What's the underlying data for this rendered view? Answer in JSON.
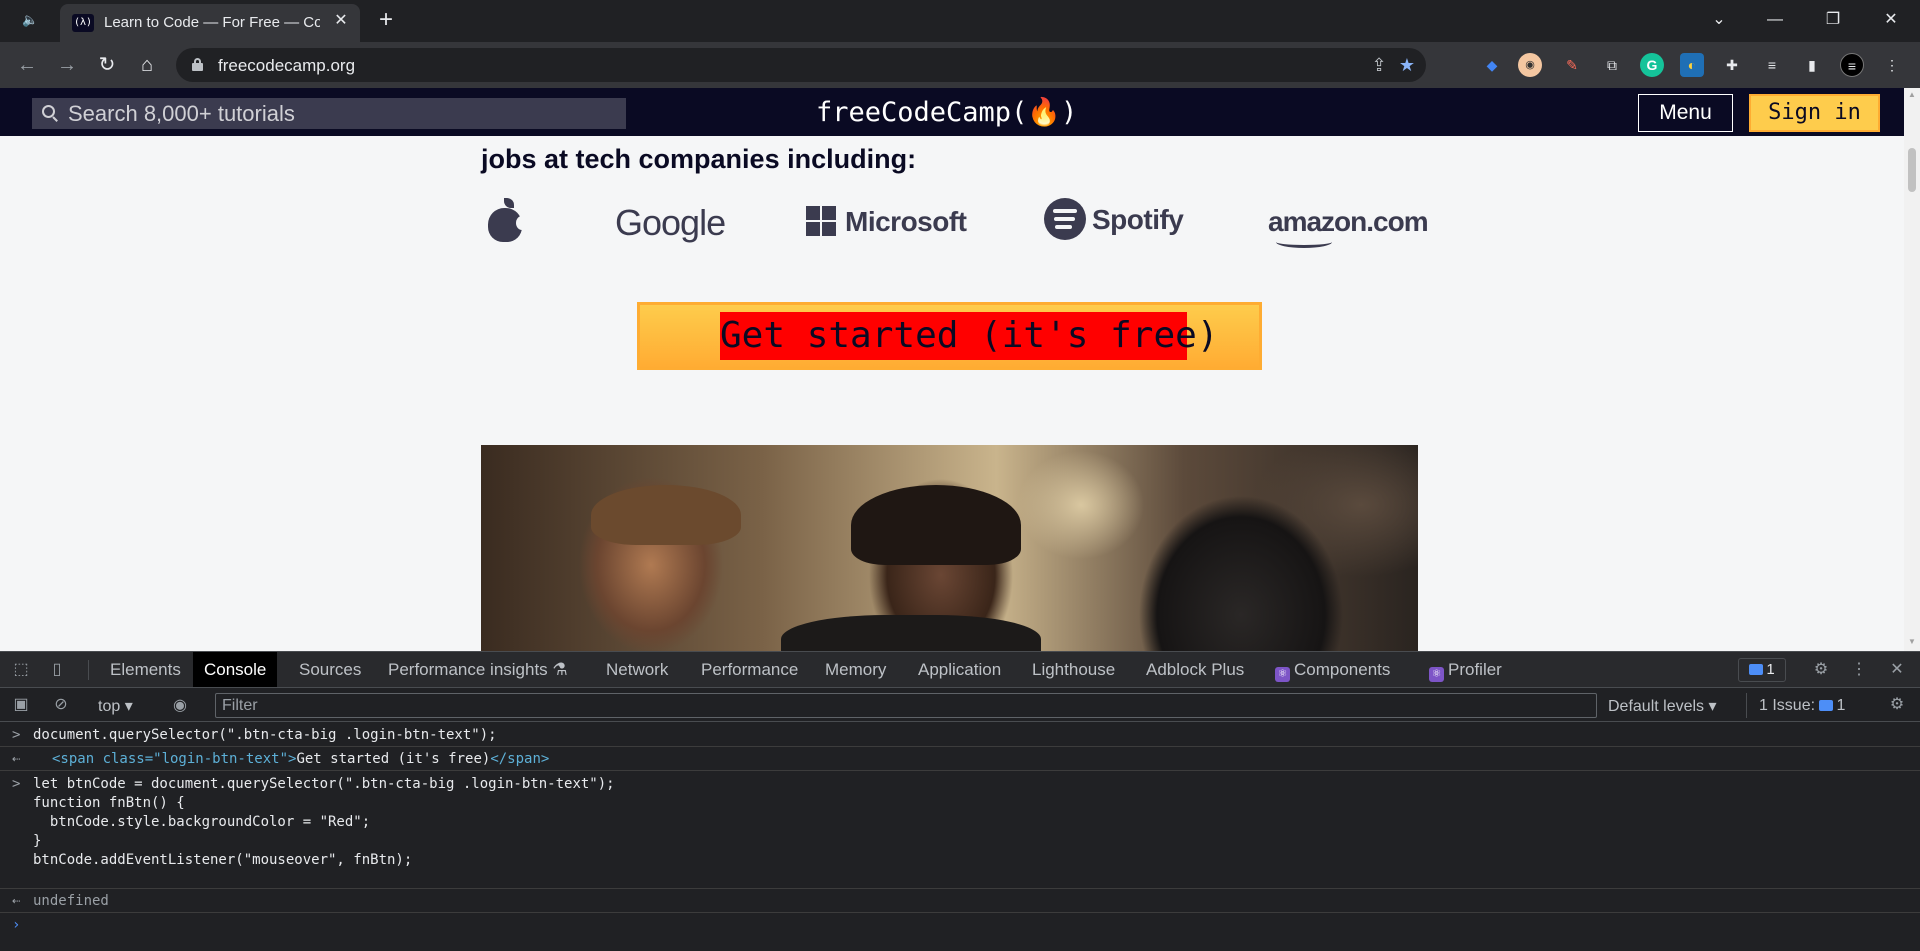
{
  "browser": {
    "tab_title": "Learn to Code — For Free — Coding Courses for Busy People",
    "favicon_text": "(λ)",
    "url": "freecodecamp.org"
  },
  "site": {
    "search_placeholder": "Search 8,000+ tutorials",
    "logo": "freeCodeCamp(🔥)",
    "menu_label": "Menu",
    "signin_label": "Sign in",
    "companies_heading": "jobs at tech companies including:",
    "companies": [
      "Apple",
      "Google",
      "Microsoft",
      "Spotify",
      "amazon.com"
    ],
    "google_text": "Google",
    "microsoft_text": "Microsoft",
    "spotify_text": "Spotify",
    "amazon_text": "amazon.com",
    "cta_label": "Get started (it's free)"
  },
  "devtools": {
    "tabs": [
      "Elements",
      "Console",
      "Sources",
      "Performance insights",
      "Network",
      "Performance",
      "Memory",
      "Application",
      "Lighthouse",
      "Adblock Plus",
      "Components",
      "Profiler"
    ],
    "active_tab": "Console",
    "message_count": "1",
    "context": "top",
    "filter_placeholder": "Filter",
    "levels": "Default levels",
    "issues": "1 Issue:",
    "issues_count": "1"
  },
  "console": {
    "line1": "document.querySelector(\".btn-cta-big .login-btn-text\");",
    "result1_open": "<span class=\"login-btn-text\">",
    "result1_text": "Get started (it's free)",
    "result1_close": "</span>",
    "code2": [
      "let btnCode = document.querySelector(\".btn-cta-big .login-btn-text\");",
      "function fnBtn() {",
      "  btnCode.style.backgroundColor = \"Red\";",
      "}",
      "btnCode.addEventListener(\"mouseover\", fnBtn);"
    ],
    "result2": "undefined"
  },
  "colors": {
    "fcc_nav": "#0a0a23",
    "cta_yellow": "#fecc4c",
    "cta_highlight": "#ff0000",
    "devtools_bg": "#202124"
  }
}
